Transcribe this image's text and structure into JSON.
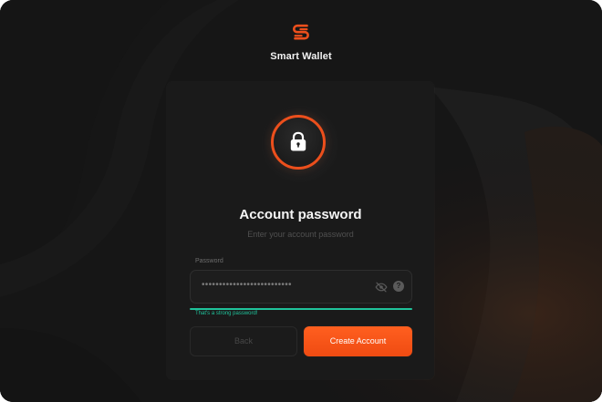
{
  "app": {
    "name": "Smart Wallet"
  },
  "icons": {
    "logo": "smart-wallet-logo-icon",
    "lock": "lock-icon",
    "eye": "eye-off-icon",
    "help": "question-mark-icon"
  },
  "colors": {
    "accent": "#ec4f1c",
    "button": "#ff5f1f",
    "success": "#1fc39b",
    "background": "#161616",
    "card": "#1a1a1a"
  },
  "auth": {
    "title": "Account password",
    "subtitle": "Enter your account password",
    "field": {
      "label": "Password",
      "value": "••••••••••••••••••••••••••",
      "help_symbol": "?"
    },
    "strength": {
      "text": "That's a strong password!",
      "level_fraction": 1.0
    },
    "buttons": {
      "back_label": "Back",
      "create_label": "Create Account"
    }
  }
}
